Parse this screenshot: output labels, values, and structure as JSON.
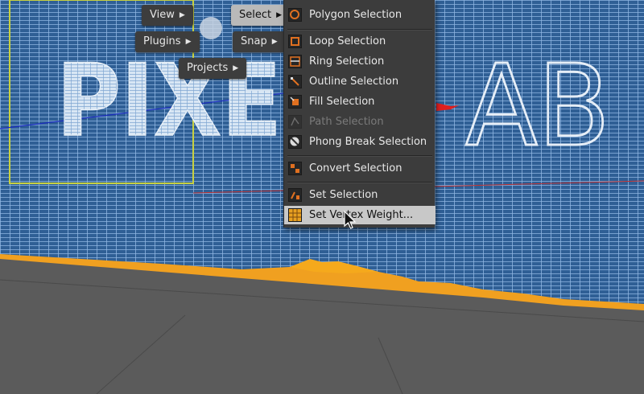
{
  "viewport": {
    "scene_text": [
      "PIXE",
      "AB"
    ],
    "colors": {
      "mesh_background": "#2f5f95",
      "mesh_line": "#9fc3ea",
      "floor": "#5b5b5b",
      "selection_weight": "#f0a020",
      "guide_box": "#c8d040"
    }
  },
  "pills": {
    "view": "View",
    "plugins": "Plugins",
    "projects": "Projects",
    "select": "Select",
    "snap": "Snap"
  },
  "menu": {
    "items": [
      {
        "label": "Polygon Selection",
        "icon": "polygon-selection-icon",
        "enabled": true
      },
      {
        "label": "Loop Selection",
        "icon": "loop-selection-icon",
        "enabled": true
      },
      {
        "label": "Ring Selection",
        "icon": "ring-selection-icon",
        "enabled": true
      },
      {
        "label": "Outline Selection",
        "icon": "outline-selection-icon",
        "enabled": true
      },
      {
        "label": "Fill Selection",
        "icon": "fill-selection-icon",
        "enabled": true
      },
      {
        "label": "Path Selection",
        "icon": "path-selection-icon",
        "enabled": false
      },
      {
        "label": "Phong Break Selection",
        "icon": "phong-break-icon",
        "enabled": true
      },
      {
        "label": "Convert Selection",
        "icon": "convert-selection-icon",
        "enabled": true
      },
      {
        "label": "Set Selection",
        "icon": "set-selection-icon",
        "enabled": true
      },
      {
        "label": "Set Vertex Weight...",
        "icon": "vertex-weight-icon",
        "enabled": true,
        "hovered": true
      }
    ]
  }
}
